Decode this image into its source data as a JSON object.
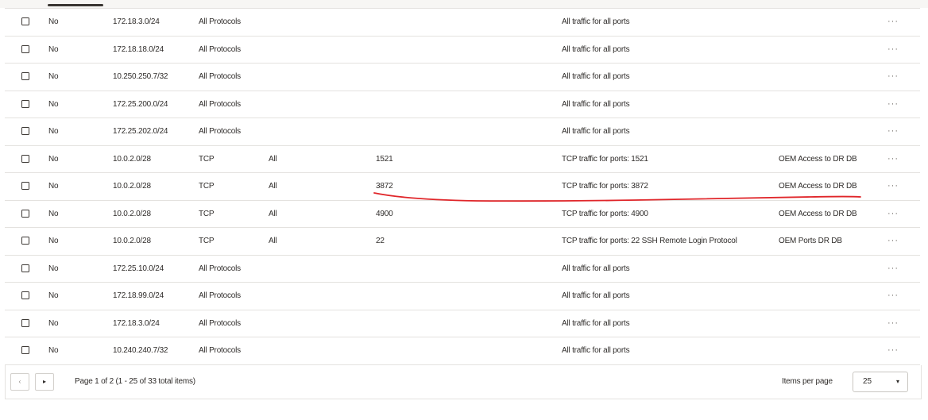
{
  "rows": [
    {
      "stateless": "No",
      "source": "172.18.3.0/24",
      "protocol": "All Protocols",
      "source_port": "",
      "dest_port": "",
      "description": "All traffic for all ports",
      "note": ""
    },
    {
      "stateless": "No",
      "source": "172.18.18.0/24",
      "protocol": "All Protocols",
      "source_port": "",
      "dest_port": "",
      "description": "All traffic for all ports",
      "note": ""
    },
    {
      "stateless": "No",
      "source": "10.250.250.7/32",
      "protocol": "All Protocols",
      "source_port": "",
      "dest_port": "",
      "description": "All traffic for all ports",
      "note": ""
    },
    {
      "stateless": "No",
      "source": "172.25.200.0/24",
      "protocol": "All Protocols",
      "source_port": "",
      "dest_port": "",
      "description": "All traffic for all ports",
      "note": ""
    },
    {
      "stateless": "No",
      "source": "172.25.202.0/24",
      "protocol": "All Protocols",
      "source_port": "",
      "dest_port": "",
      "description": "All traffic for all ports",
      "note": ""
    },
    {
      "stateless": "No",
      "source": "10.0.2.0/28",
      "protocol": "TCP",
      "source_port": "All",
      "dest_port": "1521",
      "description": "TCP traffic for ports: 1521",
      "note": "OEM Access to DR DB"
    },
    {
      "stateless": "No",
      "source": "10.0.2.0/28",
      "protocol": "TCP",
      "source_port": "All",
      "dest_port": "3872",
      "description": "TCP traffic for ports: 3872",
      "note": "OEM Access to DR DB"
    },
    {
      "stateless": "No",
      "source": "10.0.2.0/28",
      "protocol": "TCP",
      "source_port": "All",
      "dest_port": "4900",
      "description": "TCP traffic for ports: 4900",
      "note": "OEM Access to DR DB"
    },
    {
      "stateless": "No",
      "source": "10.0.2.0/28",
      "protocol": "TCP",
      "source_port": "All",
      "dest_port": "22",
      "description": "TCP traffic for ports: 22 SSH Remote Login Protocol",
      "note": "OEM Ports DR DB"
    },
    {
      "stateless": "No",
      "source": "172.25.10.0/24",
      "protocol": "All Protocols",
      "source_port": "",
      "dest_port": "",
      "description": "All traffic for all ports",
      "note": ""
    },
    {
      "stateless": "No",
      "source": "172.18.99.0/24",
      "protocol": "All Protocols",
      "source_port": "",
      "dest_port": "",
      "description": "All traffic for all ports",
      "note": ""
    },
    {
      "stateless": "No",
      "source": "172.18.3.0/24",
      "protocol": "All Protocols",
      "source_port": "",
      "dest_port": "",
      "description": "All traffic for all ports",
      "note": ""
    },
    {
      "stateless": "No",
      "source": "10.240.240.7/32",
      "protocol": "All Protocols",
      "source_port": "",
      "dest_port": "",
      "description": "All traffic for all ports",
      "note": ""
    }
  ],
  "row_menu_glyph": "···",
  "pagination": {
    "prev_icon": "‹",
    "next_icon": "▸",
    "info": "Page 1 of 2 (1 - 25 of 33 total items)",
    "items_per_page_label": "Items per page",
    "items_per_page_value": "25",
    "caret": "▾"
  },
  "annotation": {
    "color": "#e0262a",
    "type": "hand-drawn underline"
  }
}
